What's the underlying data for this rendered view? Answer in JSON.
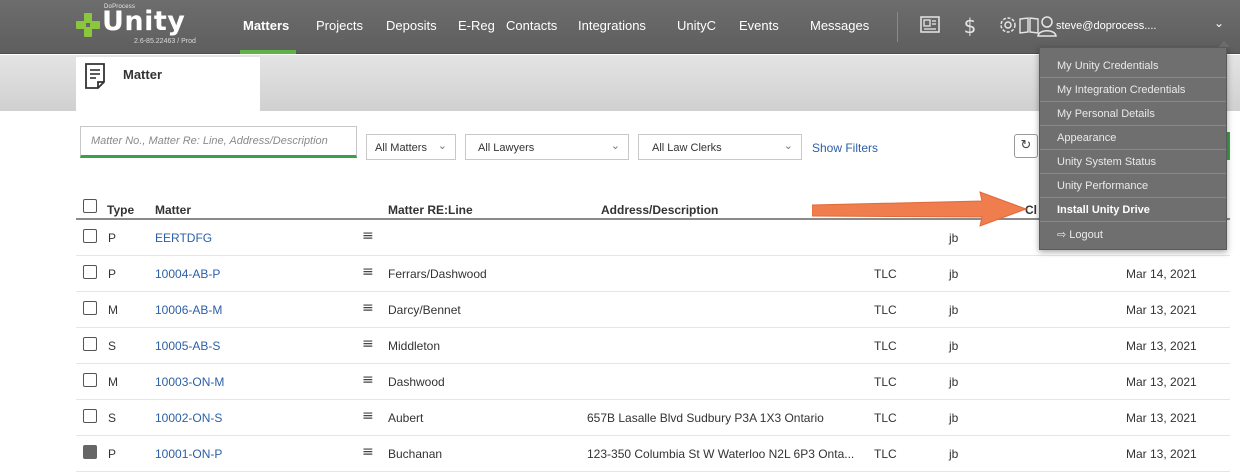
{
  "app": {
    "brand_small": "DoProcess",
    "logo_text": "Unity",
    "version": "2.6-85.22463 / Prod"
  },
  "nav": {
    "items": [
      "Matters",
      "Projects",
      "Deposits",
      "E-Reg",
      "Contacts",
      "Integrations",
      "UnityC",
      "Events",
      "Messages"
    ],
    "active": "Matters"
  },
  "toolbar_icons": [
    "newspaper-icon",
    "dollar-icon",
    "gear-icon",
    "book-icon"
  ],
  "user": {
    "email": "steve@doprocess....",
    "menu": [
      "My Unity Credentials",
      "My Integration Credentials",
      "My Personal Details",
      "Appearance",
      "Unity System Status",
      "Unity Performance",
      "Install Unity Drive",
      "Logout"
    ],
    "highlighted": "Install Unity Drive"
  },
  "page": {
    "tab_label": "Matter"
  },
  "filters": {
    "search_placeholder": "Matter No., Matter Re: Line, Address/Description",
    "matters": "All Matters",
    "lawyers": "All Lawyers",
    "law_clerks": "All Law Clerks",
    "show_filters": "Show Filters"
  },
  "table": {
    "headers": {
      "type": "Type",
      "matter": "Matter",
      "reline": "Matter RE:Line",
      "address": "Address/Description",
      "partial": "Cl"
    },
    "rows": [
      {
        "type": "P",
        "matter": "EERTDFG",
        "reline": "",
        "address": "",
        "code": "",
        "clerk": "jb",
        "date": "",
        "locked": false
      },
      {
        "type": "P",
        "matter": "10004-AB-P",
        "reline": "Ferrars/Dashwood",
        "address": "",
        "code": "TLC",
        "clerk": "jb",
        "date": "Mar 14, 2021",
        "locked": false
      },
      {
        "type": "M",
        "matter": "10006-AB-M",
        "reline": "Darcy/Bennet",
        "address": "",
        "code": "TLC",
        "clerk": "jb",
        "date": "Mar 13, 2021",
        "locked": false
      },
      {
        "type": "S",
        "matter": "10005-AB-S",
        "reline": "Middleton",
        "address": "",
        "code": "TLC",
        "clerk": "jb",
        "date": "Mar 13, 2021",
        "locked": false
      },
      {
        "type": "M",
        "matter": "10003-ON-M",
        "reline": "Dashwood",
        "address": "",
        "code": "TLC",
        "clerk": "jb",
        "date": "Mar 13, 2021",
        "locked": false
      },
      {
        "type": "S",
        "matter": "10002-ON-S",
        "reline": "Aubert",
        "address": "657B Lasalle Blvd Sudbury P3A 1X3 Ontario",
        "code": "TLC",
        "clerk": "jb",
        "date": "Mar 13, 2021",
        "locked": false
      },
      {
        "type": "P",
        "matter": "10001-ON-P",
        "reline": "Buchanan",
        "address": "123-350 Columbia St W Waterloo N2L 6P3 Onta...",
        "code": "TLC",
        "clerk": "jb",
        "date": "Mar 13, 2021",
        "locked": true
      }
    ]
  },
  "colors": {
    "topbar": "#666666",
    "accent_green": "#5fb246",
    "link_blue": "#2b5fa8",
    "annotation_arrow": "#ef7d4e",
    "dropdown_bg": "#6f6f6f"
  }
}
